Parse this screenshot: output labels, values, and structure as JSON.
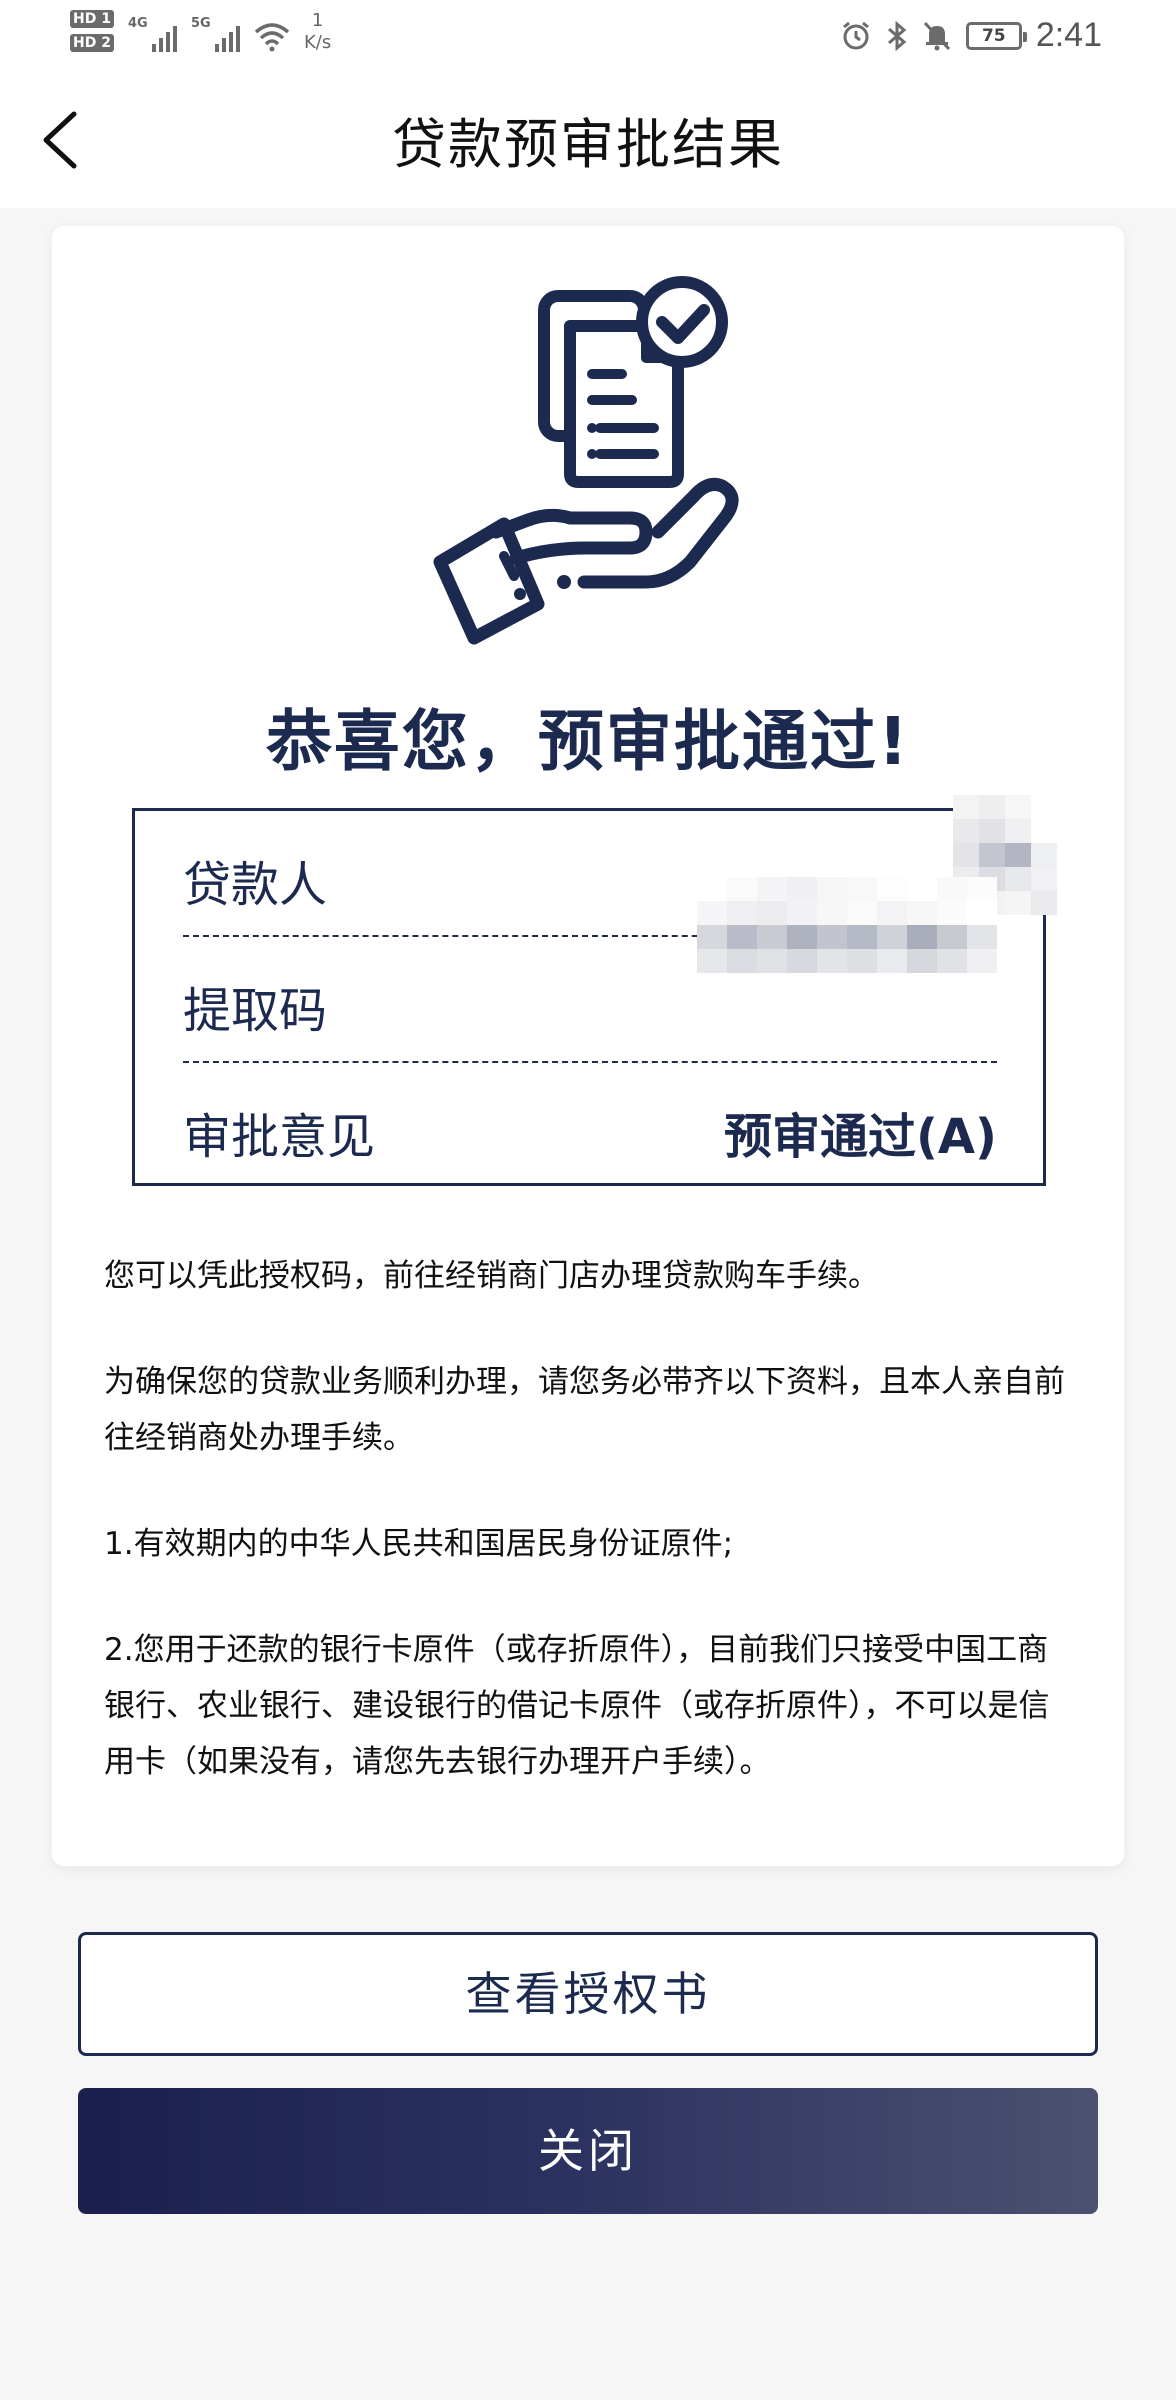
{
  "status_bar": {
    "hd1": "HD 1",
    "hd2": "HD 2",
    "net1": "4G",
    "net2": "5G",
    "speed_value": "1",
    "speed_unit": "K/s",
    "battery": "75",
    "time": "2:41"
  },
  "header": {
    "title": "贷款预审批结果",
    "back_icon": "chevron-left-icon"
  },
  "result": {
    "illustration_icon": "hand-holding-approved-document-icon",
    "title": "恭喜您，预审批通过!",
    "rows": [
      {
        "label": "贷款人",
        "value": ""
      },
      {
        "label": "提取码",
        "value": ""
      },
      {
        "label": "审批意见",
        "value": "预审通过(A)"
      }
    ]
  },
  "notes": [
    "您可以凭此授权码，前往经销商门店办理贷款购车手续。",
    "为确保您的贷款业务顺利办理，请您务必带齐以下资料，且本人亲自前往经销商处办理手续。",
    "1.有效期内的中华人民共和国居民身份证原件;",
    "2.您用于还款的银行卡原件（或存折原件），目前我们只接受中国工商银行、农业银行、建设银行的借记卡原件（或存折原件），不可以是信用卡（如果没有，请您先去银行办理开户手续）。"
  ],
  "buttons": {
    "view_auth": "查看授权书",
    "close": "关闭"
  },
  "colors": {
    "primary": "#1c2a4f",
    "close_gradient_start": "#1a1f4d",
    "close_gradient_end": "#4c5170"
  }
}
